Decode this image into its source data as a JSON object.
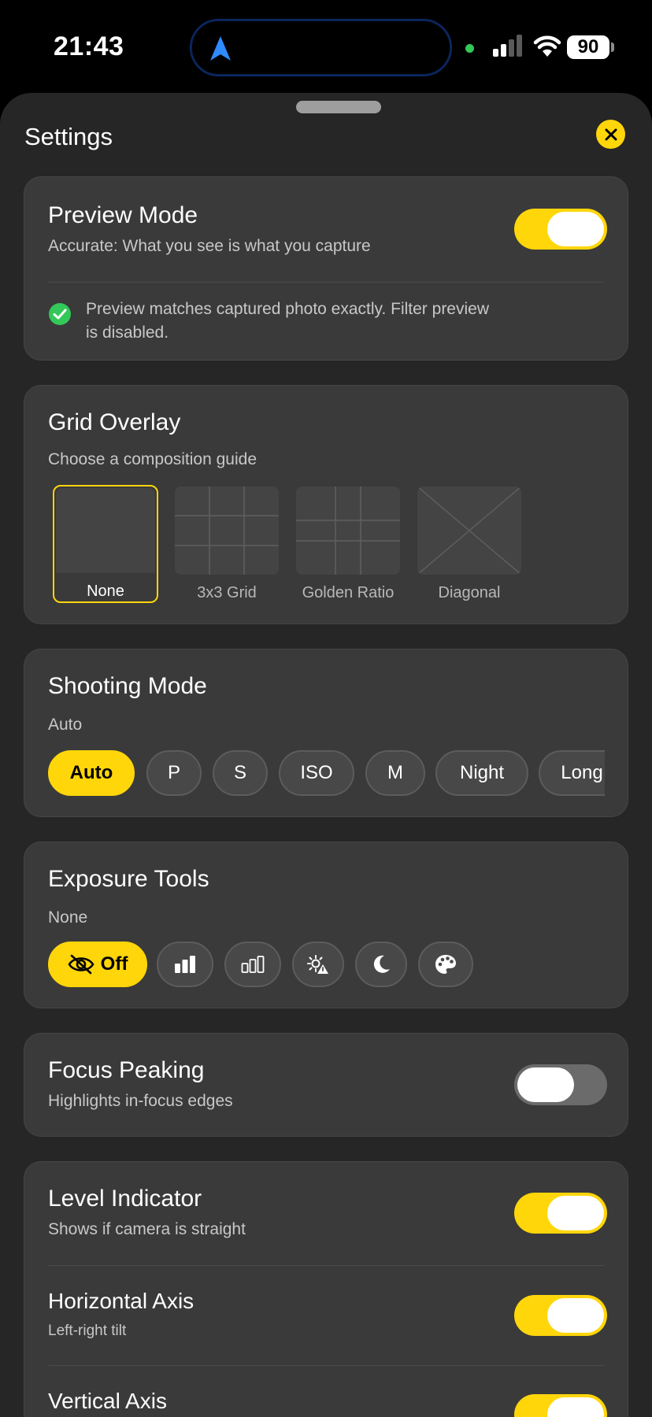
{
  "status_bar": {
    "time": "21:43",
    "battery": "90"
  },
  "sheet": {
    "title": "Settings"
  },
  "preview_mode": {
    "title": "Preview Mode",
    "subtitle": "Accurate: What you see is what you capture",
    "enabled": true,
    "note_line1": "Preview matches captured photo exactly. Filter preview",
    "note_line2": "is disabled."
  },
  "grid_overlay": {
    "title": "Grid Overlay",
    "subtitle": "Choose a composition guide",
    "options": [
      {
        "label": "None",
        "selected": true
      },
      {
        "label": "3x3 Grid",
        "selected": false
      },
      {
        "label": "Golden Ratio",
        "selected": false
      },
      {
        "label": "Diagonal",
        "selected": false
      }
    ]
  },
  "shooting_mode": {
    "title": "Shooting Mode",
    "current": "Auto",
    "modes": [
      "Auto",
      "P",
      "S",
      "ISO",
      "M",
      "Night",
      "Long"
    ]
  },
  "exposure_tools": {
    "title": "Exposure Tools",
    "current": "None",
    "off_label": "Off",
    "tools": [
      "eye-slash-icon",
      "histogram-filled-icon",
      "histogram-outline-icon",
      "zebra-warning-icon",
      "moon-icon",
      "palette-icon"
    ]
  },
  "focus_peaking": {
    "title": "Focus Peaking",
    "subtitle": "Highlights in-focus edges",
    "enabled": false
  },
  "level_indicator": {
    "title": "Level Indicator",
    "subtitle": "Shows if camera is straight",
    "enabled": true,
    "horizontal": {
      "title": "Horizontal Axis",
      "subtitle": "Left-right tilt",
      "enabled": true
    },
    "vertical": {
      "title": "Vertical Axis",
      "enabled": true
    }
  },
  "colors": {
    "accent": "#ffd60a",
    "card": "#3a3a3a",
    "sheet": "#262626",
    "success": "#34c759"
  }
}
